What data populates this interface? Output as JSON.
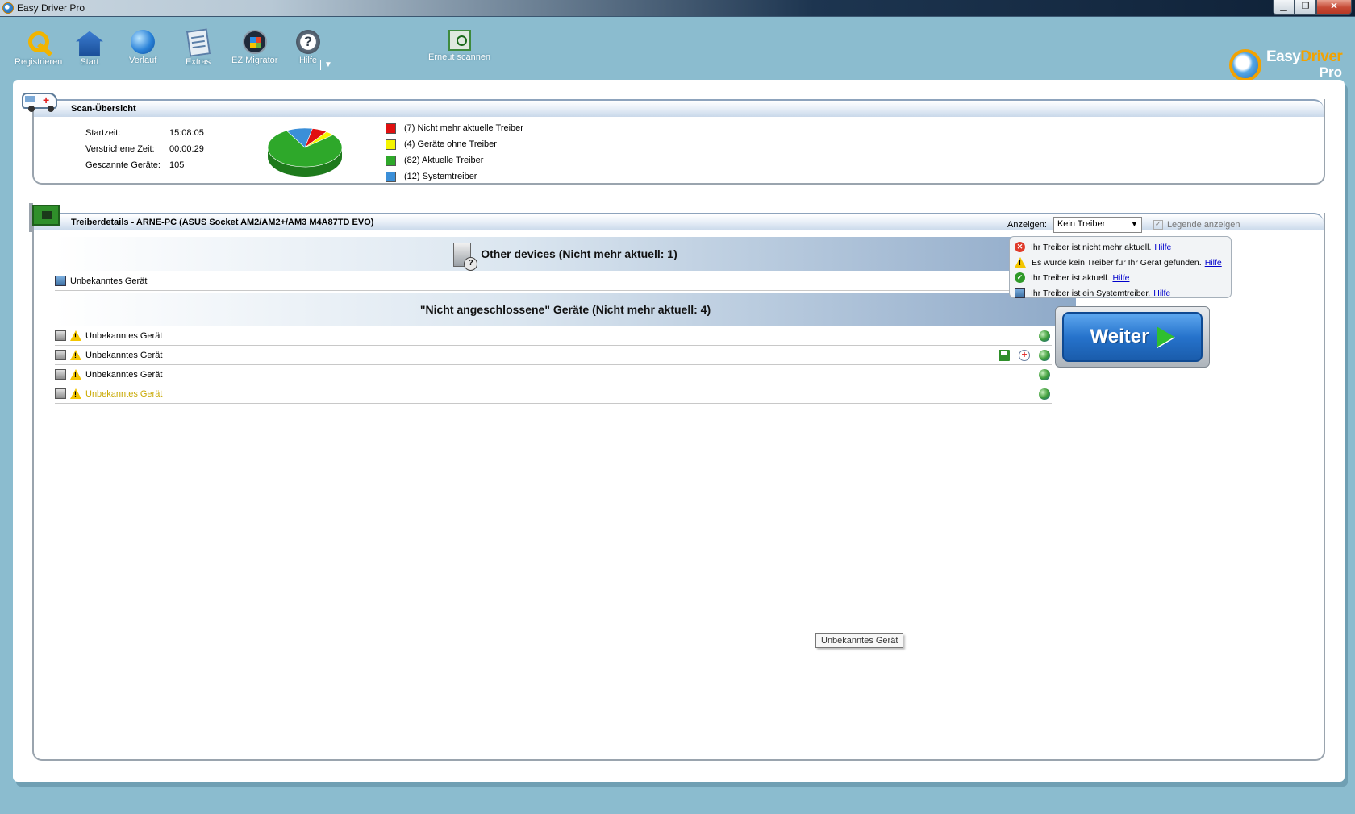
{
  "window": {
    "title": "Easy Driver Pro",
    "min": "▁",
    "max": "❐",
    "close": "✕"
  },
  "toolbar": {
    "registrieren": "Registrieren",
    "start": "Start",
    "verlauf": "Verlauf",
    "extras": "Extras",
    "ez_migrator": "EZ Migrator",
    "hilfe": "Hilfe",
    "hilfe_arrow": "▼",
    "erneut_scannen": "Erneut scannen"
  },
  "logo": {
    "easy": "Easy",
    "driver": "Driver",
    "pro": "Pro"
  },
  "scan": {
    "title": "Scan-Übersicht",
    "startzeit_label": "Startzeit:",
    "startzeit_value": "15:08:05",
    "verstrichen_label": "Verstrichene Zeit:",
    "verstrichen_value": "00:00:29",
    "geraete_label": "Gescannte Geräte:",
    "geraete_value": "105",
    "legend": [
      {
        "label": "(7) Nicht mehr aktuelle Treiber",
        "color": "#e01010"
      },
      {
        "label": "(4) Geräte ohne Treiber",
        "color": "#f5f500"
      },
      {
        "label": "(82) Aktuelle Treiber",
        "color": "#2ea82a"
      },
      {
        "label": "(12) Systemtreiber",
        "color": "#3b8fd8"
      }
    ],
    "pie_values": [
      7,
      4,
      82,
      12
    ]
  },
  "details": {
    "title": "Treiberdetails - ARNE-PC (ASUS Socket AM2/AM2+/AM3 M4A87TD EVO)",
    "anzeigen_label": "Anzeigen:",
    "anzeigen_value": "Kein Treiber",
    "legende_label": "Legende anzeigen",
    "group1": "Other devices (Nicht mehr aktuell: 1)",
    "group1_row": "Unbekanntes Gerät",
    "group2": "\"Nicht angeschlossene\" Geräte (Nicht mehr aktuell: 4)",
    "group2_rows": [
      "Unbekanntes Gerät",
      "Unbekanntes Gerät",
      "Unbekanntes Gerät",
      "Unbekanntes Gerät"
    ],
    "tooltip": "Unbekanntes Gerät"
  },
  "legendbox": {
    "items": [
      {
        "text": "Ihr Treiber ist nicht mehr aktuell.",
        "link": "Hilfe"
      },
      {
        "text": "Es wurde kein Treiber für Ihr Gerät gefunden.",
        "link": "Hilfe"
      },
      {
        "text": "Ihr Treiber ist aktuell.",
        "link": "Hilfe"
      },
      {
        "text": "Ihr Treiber ist ein Systemtreiber.",
        "link": "Hilfe"
      }
    ]
  },
  "weiter": {
    "label": "Weiter"
  }
}
